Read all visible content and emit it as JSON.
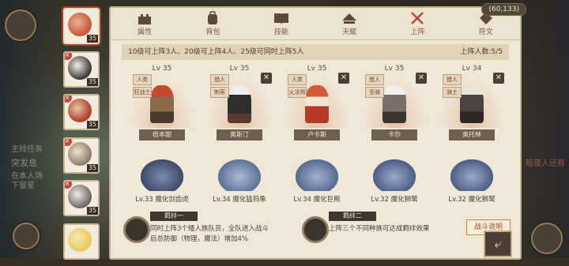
{
  "coins": "(60,133)",
  "tabs": [
    {
      "label": "属性",
      "icon": "castle-icon",
      "active": false
    },
    {
      "label": "背包",
      "icon": "backpack-icon",
      "active": false
    },
    {
      "label": "技能",
      "icon": "book-icon",
      "active": false
    },
    {
      "label": "天赋",
      "icon": "talent-icon",
      "active": false
    },
    {
      "label": "上阵",
      "icon": "crossed-swords-icon",
      "active": true
    },
    {
      "label": "符文",
      "icon": "rune-icon",
      "active": false
    }
  ],
  "roster": [
    {
      "level": "35",
      "selected": true,
      "color": "#c65b3a"
    },
    {
      "level": "35",
      "selected": false,
      "color": "#d8d4cf"
    },
    {
      "level": "35",
      "selected": false,
      "color": "#b2452c"
    },
    {
      "level": "35",
      "selected": false,
      "color": "#8c7c65"
    },
    {
      "level": "35",
      "selected": false,
      "color": "#c8c2b8"
    },
    {
      "level": "",
      "selected": false,
      "color": "#e7c85b"
    }
  ],
  "info": {
    "rule": "10级可上阵3人、20级可上阵4人、25级可同时上阵5人",
    "count": "上阵人数:5/5"
  },
  "slots": [
    {
      "level": "Lv 35",
      "name": "梧本朗",
      "tags": [
        "人类",
        "狂战士"
      ],
      "removable": false,
      "color": "#b8493a"
    },
    {
      "level": "Lv 35",
      "name": "奥斯汀",
      "tags": [
        "猎人",
        "刺客"
      ],
      "removable": true,
      "color": "#3a3a3a"
    },
    {
      "level": "Lv 35",
      "name": "卢卡斯",
      "tags": [
        "人类",
        "火法师"
      ],
      "removable": true,
      "color": "#c14a2e"
    },
    {
      "level": "Lv 35",
      "name": "卡尔",
      "tags": [
        "猎人",
        "圣骑"
      ],
      "removable": true,
      "color": "#6e6a6a"
    },
    {
      "level": "Lv 34",
      "name": "奥托林",
      "tags": [
        "猎人",
        "骑士"
      ],
      "removable": true,
      "color": "#5e5a56"
    }
  ],
  "pets": [
    {
      "label": "Lv.33 魔化剑齿虎",
      "color": "#5b6b8c"
    },
    {
      "label": "Lv.34 魔化猛犸象",
      "color": "#7d90b0"
    },
    {
      "label": "Lv.34 魔化巨熊",
      "color": "#7c8cae"
    },
    {
      "label": "Lv.32 魔化狮鹫",
      "color": "#6b7ea4"
    },
    {
      "label": "Lv.32 魔化狮鹫",
      "color": "#6b7ea4"
    }
  ],
  "bonds": [
    {
      "title": "羁绊一",
      "line1": "同时上阵3个矮人族队员，全队进入战斗",
      "line2": "后总防御（物理，魔法）增加4%"
    },
    {
      "title": "羁绊二",
      "line1": "上阵三个不同种族可达成羁绊效果",
      "line2": ""
    }
  ],
  "battle_button": "战斗说明",
  "background_text": {
    "main_quest": "主线任务",
    "quest_line": "突发息",
    "quest_sub1": "在本人场",
    "quest_sub2": "下留星",
    "right_text": "暗夜人还有"
  }
}
